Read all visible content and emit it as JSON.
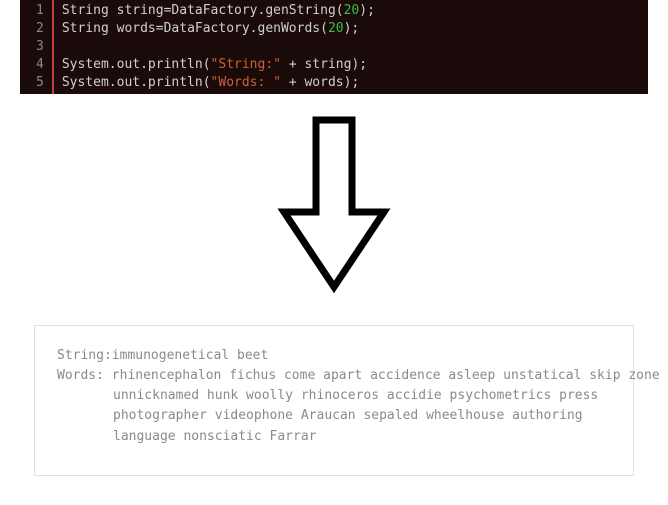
{
  "code": {
    "lines": [
      {
        "n": "1",
        "tokens": [
          {
            "cls": "tk-type",
            "t": "String "
          },
          {
            "cls": "tk-ident",
            "t": "string=DataFactory.genString("
          },
          {
            "cls": "tk-num",
            "t": "20"
          },
          {
            "cls": "tk-punc",
            "t": ");"
          }
        ]
      },
      {
        "n": "2",
        "tokens": [
          {
            "cls": "tk-type",
            "t": "String "
          },
          {
            "cls": "tk-ident",
            "t": "words=DataFactory.genWords("
          },
          {
            "cls": "tk-num",
            "t": "20"
          },
          {
            "cls": "tk-punc",
            "t": ");"
          }
        ]
      },
      {
        "n": "3",
        "tokens": []
      },
      {
        "n": "4",
        "tokens": [
          {
            "cls": "tk-ident",
            "t": "System.out.println("
          },
          {
            "cls": "tk-str",
            "t": "\"String:\""
          },
          {
            "cls": "tk-ident",
            "t": " + string);"
          }
        ]
      },
      {
        "n": "5",
        "tokens": [
          {
            "cls": "tk-ident",
            "t": "System.out.println("
          },
          {
            "cls": "tk-str",
            "t": "\"Words: \""
          },
          {
            "cls": "tk-ident",
            "t": " + words);"
          }
        ]
      }
    ]
  },
  "output": {
    "string_label": "String:",
    "string_value": "immunogenetical beet",
    "words_label": "Words: ",
    "words_lines": [
      "rhinencephalon fichus come apart accidence asleep unstatical skip zone",
      "unnicknamed hunk woolly rhinoceros accidie psychometrics press",
      "photographer videophone Araucan sepaled wheelhouse authoring",
      "language nonsciatic Farrar"
    ]
  }
}
